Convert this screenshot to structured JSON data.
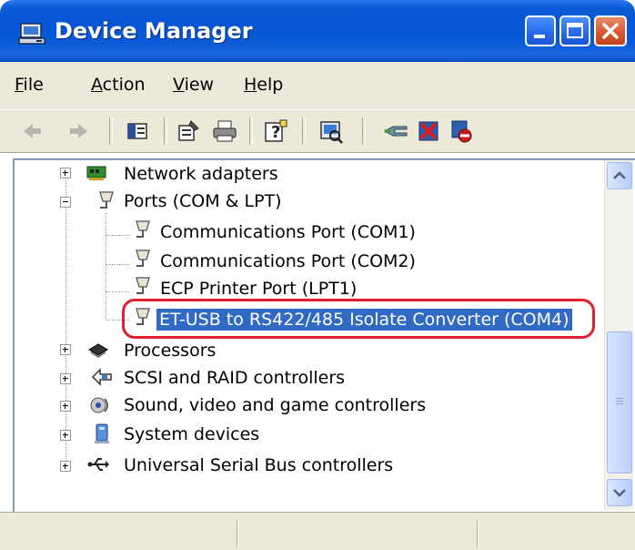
{
  "window": {
    "title": "Device Manager",
    "icon": "device-manager-icon"
  },
  "caption_buttons": [
    "minimize",
    "maximize",
    "close"
  ],
  "menu": {
    "items": [
      {
        "label": "File",
        "icon": ""
      },
      {
        "label": "Action"
      },
      {
        "label": "View"
      },
      {
        "label": "Help"
      }
    ]
  },
  "toolbar": {
    "buttons": [
      "back-arrow-icon",
      "forward-arrow-icon",
      "show-hide-tree-icon",
      "properties-icon",
      "print-icon",
      "help-icon",
      "scan-hardware-icon",
      "update-driver-icon",
      "uninstall-icon",
      "disable-icon"
    ]
  },
  "tree": {
    "items": [
      {
        "label": "Network adapters",
        "icon": "network-adapter-icon",
        "expanded": false
      },
      {
        "label": "Ports (COM & LPT)",
        "icon": "port-connector-icon",
        "expanded": true
      },
      {
        "label": "Communications Port (COM1)",
        "icon": "port-connector-icon"
      },
      {
        "label": "Communications Port (COM2)",
        "icon": "port-connector-icon"
      },
      {
        "label": "ECP Printer Port (LPT1)",
        "icon": "port-connector-icon"
      },
      {
        "label": "ET-USB to RS422/485 Isolate Converter (COM4)",
        "icon": "port-connector-icon",
        "selected": true
      },
      {
        "label": "Processors",
        "icon": "processor-icon",
        "expanded": false
      },
      {
        "label": "SCSI and RAID controllers",
        "icon": "scsi-controller-icon",
        "expanded": false
      },
      {
        "label": "Sound, video and game controllers",
        "icon": "sound-icon",
        "expanded": false
      },
      {
        "label": "System devices",
        "icon": "system-device-icon",
        "expanded": false
      },
      {
        "label": "Universal Serial Bus controllers",
        "icon": "usb-icon",
        "expanded": false
      }
    ]
  },
  "colors": {
    "titlebar": "#0a5ad8",
    "selection": "#316ac5",
    "highlight_outline": "#e0202a"
  }
}
